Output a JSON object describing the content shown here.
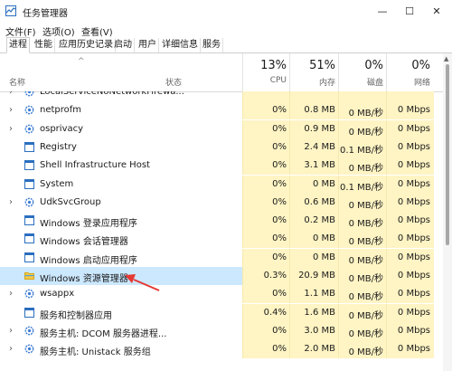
{
  "window": {
    "title": "任务管理器"
  },
  "menu": [
    "文件(F)",
    "选项(O)",
    "查看(V)"
  ],
  "tabs": [
    "进程",
    "性能",
    "应用历史记录",
    "启动",
    "用户",
    "详细信息",
    "服务"
  ],
  "columns": {
    "name": "名称",
    "status": "状态",
    "cpu": {
      "percent": "13%",
      "label": "CPU"
    },
    "mem": {
      "percent": "51%",
      "label": "内存"
    },
    "disk": {
      "percent": "0%",
      "label": "磁盘"
    },
    "net": {
      "percent": "0%",
      "label": "网络"
    }
  },
  "processes": [
    {
      "name": "LocalServiceNoNetworkFirewa...",
      "cpu": "",
      "mem": "",
      "disk": "",
      "net": "",
      "expand": true,
      "icon": "gear"
    },
    {
      "name": "netprofm",
      "cpu": "0%",
      "mem": "0.8 MB",
      "disk": "0 MB/秒",
      "net": "0 Mbps",
      "expand": true,
      "icon": "gear"
    },
    {
      "name": "osprivacy",
      "cpu": "0%",
      "mem": "0.9 MB",
      "disk": "0 MB/秒",
      "net": "0 Mbps",
      "expand": true,
      "icon": "gear"
    },
    {
      "name": "Registry",
      "cpu": "0%",
      "mem": "2.4 MB",
      "disk": "0.1 MB/秒",
      "net": "0 Mbps",
      "expand": false,
      "icon": "window"
    },
    {
      "name": "Shell Infrastructure Host",
      "cpu": "0%",
      "mem": "3.1 MB",
      "disk": "0 MB/秒",
      "net": "0 Mbps",
      "expand": false,
      "icon": "window"
    },
    {
      "name": "System",
      "cpu": "0%",
      "mem": "0 MB",
      "disk": "0.1 MB/秒",
      "net": "0 Mbps",
      "expand": false,
      "icon": "window"
    },
    {
      "name": "UdkSvcGroup",
      "cpu": "0%",
      "mem": "0.6 MB",
      "disk": "0 MB/秒",
      "net": "0 Mbps",
      "expand": true,
      "icon": "gear"
    },
    {
      "name": "Windows 登录应用程序",
      "cpu": "0%",
      "mem": "0.2 MB",
      "disk": "0 MB/秒",
      "net": "0 Mbps",
      "expand": false,
      "icon": "window"
    },
    {
      "name": "Windows 会话管理器",
      "cpu": "0%",
      "mem": "0 MB",
      "disk": "0 MB/秒",
      "net": "0 Mbps",
      "expand": false,
      "icon": "window"
    },
    {
      "name": "Windows 启动应用程序",
      "cpu": "0%",
      "mem": "0 MB",
      "disk": "0 MB/秒",
      "net": "0 Mbps",
      "expand": false,
      "icon": "window"
    },
    {
      "name": "Windows 资源管理器",
      "cpu": "0.3%",
      "mem": "20.9 MB",
      "disk": "0 MB/秒",
      "net": "0 Mbps",
      "expand": false,
      "icon": "folder",
      "selected": true
    },
    {
      "name": "wsappx",
      "cpu": "0%",
      "mem": "1.1 MB",
      "disk": "0 MB/秒",
      "net": "0 Mbps",
      "expand": true,
      "icon": "gear"
    },
    {
      "name": "服务和控制器应用",
      "cpu": "0.4%",
      "mem": "1.6 MB",
      "disk": "0 MB/秒",
      "net": "0 Mbps",
      "expand": false,
      "icon": "window"
    },
    {
      "name": "服务主机: DCOM 服务器进程...",
      "cpu": "0%",
      "mem": "3.0 MB",
      "disk": "0 MB/秒",
      "net": "0 Mbps",
      "expand": true,
      "icon": "gear"
    },
    {
      "name": "服务主机: Unistack 服务组",
      "cpu": "0%",
      "mem": "2.0 MB",
      "disk": "0 MB/秒",
      "net": "0 Mbps",
      "expand": true,
      "icon": "gear"
    }
  ],
  "colors": {
    "usage_bg": "#fff4c4",
    "selected_bg": "#cce8ff",
    "annotation_arrow": "#e53935"
  }
}
